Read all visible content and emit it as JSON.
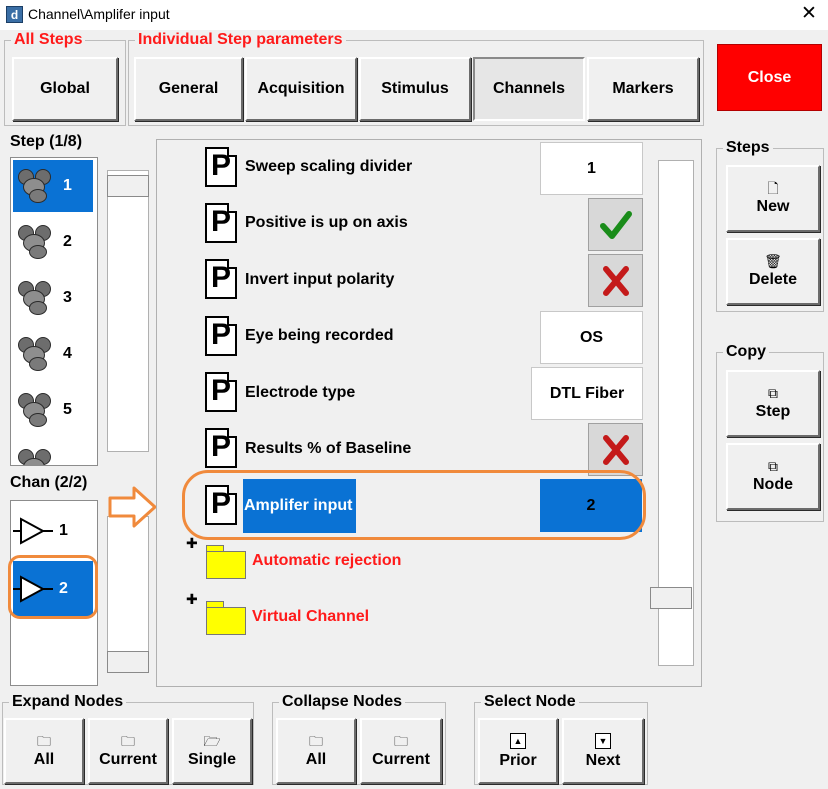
{
  "window": {
    "title": "Channel\\Amplifer input",
    "app_icon": "d"
  },
  "all_steps": {
    "label": "All Steps",
    "global_button": "Global"
  },
  "individual": {
    "label": "Individual Step parameters",
    "tabs": [
      "General",
      "Acquisition",
      "Stimulus",
      "Channels",
      "Markers"
    ],
    "active_tab": "Channels"
  },
  "close_button": "Close",
  "step_list": {
    "label": "Step (1/8)",
    "items": [
      "1",
      "2",
      "3",
      "4",
      "5"
    ],
    "selected": "1"
  },
  "chan_list": {
    "label": "Chan (2/2)",
    "items": [
      "1",
      "2"
    ],
    "selected": "2"
  },
  "params": [
    {
      "label": "Sweep scaling divider",
      "value": "1",
      "kind": "text"
    },
    {
      "label": "Positive is up on axis",
      "value": "checked",
      "kind": "check"
    },
    {
      "label": "Invert input polarity",
      "value": "unchecked",
      "kind": "check"
    },
    {
      "label": "Eye being recorded",
      "value": "OS",
      "kind": "text"
    },
    {
      "label": "Electrode type",
      "value": "DTL Fiber",
      "kind": "text"
    },
    {
      "label": "Results % of Baseline",
      "value": "unchecked",
      "kind": "check"
    },
    {
      "label": "Amplifer input",
      "value": "2",
      "kind": "text",
      "selected": true
    }
  ],
  "nodes": [
    "Automatic rejection",
    "Virtual Channel"
  ],
  "steps_group": {
    "label": "Steps",
    "new": "New",
    "delete": "Delete"
  },
  "copy_group": {
    "label": "Copy",
    "step": "Step",
    "node": "Node"
  },
  "expand_nodes": {
    "label": "Expand Nodes",
    "all": "All",
    "current": "Current",
    "single": "Single"
  },
  "collapse_nodes": {
    "label": "Collapse Nodes",
    "all": "All",
    "current": "Current"
  },
  "select_node": {
    "label": "Select Node",
    "prior": "Prior",
    "next": "Next"
  },
  "colors": {
    "selection": "#0a72d4",
    "close": "#ff0000",
    "annotation": "#f08a3c",
    "group_label": "#ff1a1a"
  }
}
